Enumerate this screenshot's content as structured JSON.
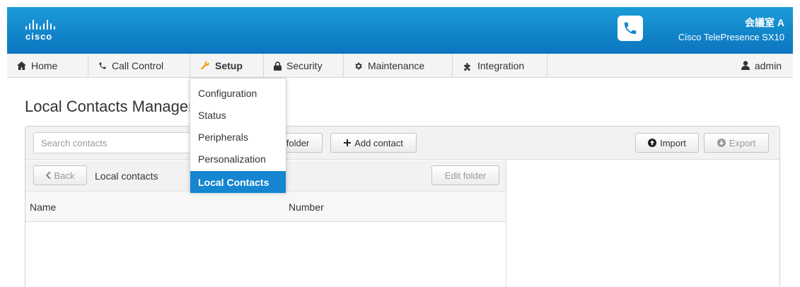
{
  "header": {
    "brand": "cisco",
    "room_name": "会議室 A",
    "device_model": "Cisco TelePresence SX10",
    "phone_icon": "phone-icon",
    "accent_color": "#0b75bf"
  },
  "nav": {
    "items": [
      {
        "label": "Home",
        "icon": "home-icon"
      },
      {
        "label": "Call Control",
        "icon": "phone-icon"
      },
      {
        "label": "Setup",
        "icon": "wrench-icon"
      },
      {
        "label": "Security",
        "icon": "lock-icon"
      },
      {
        "label": "Maintenance",
        "icon": "gear-icon"
      },
      {
        "label": "Integration",
        "icon": "puzzle-icon"
      }
    ],
    "active": "Setup",
    "user": "admin"
  },
  "setup_menu": {
    "items": [
      "Configuration",
      "Status",
      "Peripherals",
      "Personalization",
      "Local Contacts"
    ],
    "selected": "Local Contacts",
    "selected_color": "#1586cf"
  },
  "page": {
    "title": "Local Contacts Management"
  },
  "toolbar": {
    "search_placeholder": "Search contacts",
    "folder_button": "folder",
    "add_contact_button": "Add contact",
    "import_button": "Import",
    "export_button": "Export"
  },
  "contacts": {
    "back_button": "Back",
    "breadcrumb": "Local contacts",
    "edit_folder_button": "Edit folder",
    "columns": [
      "Name",
      "Number"
    ],
    "rows": []
  }
}
